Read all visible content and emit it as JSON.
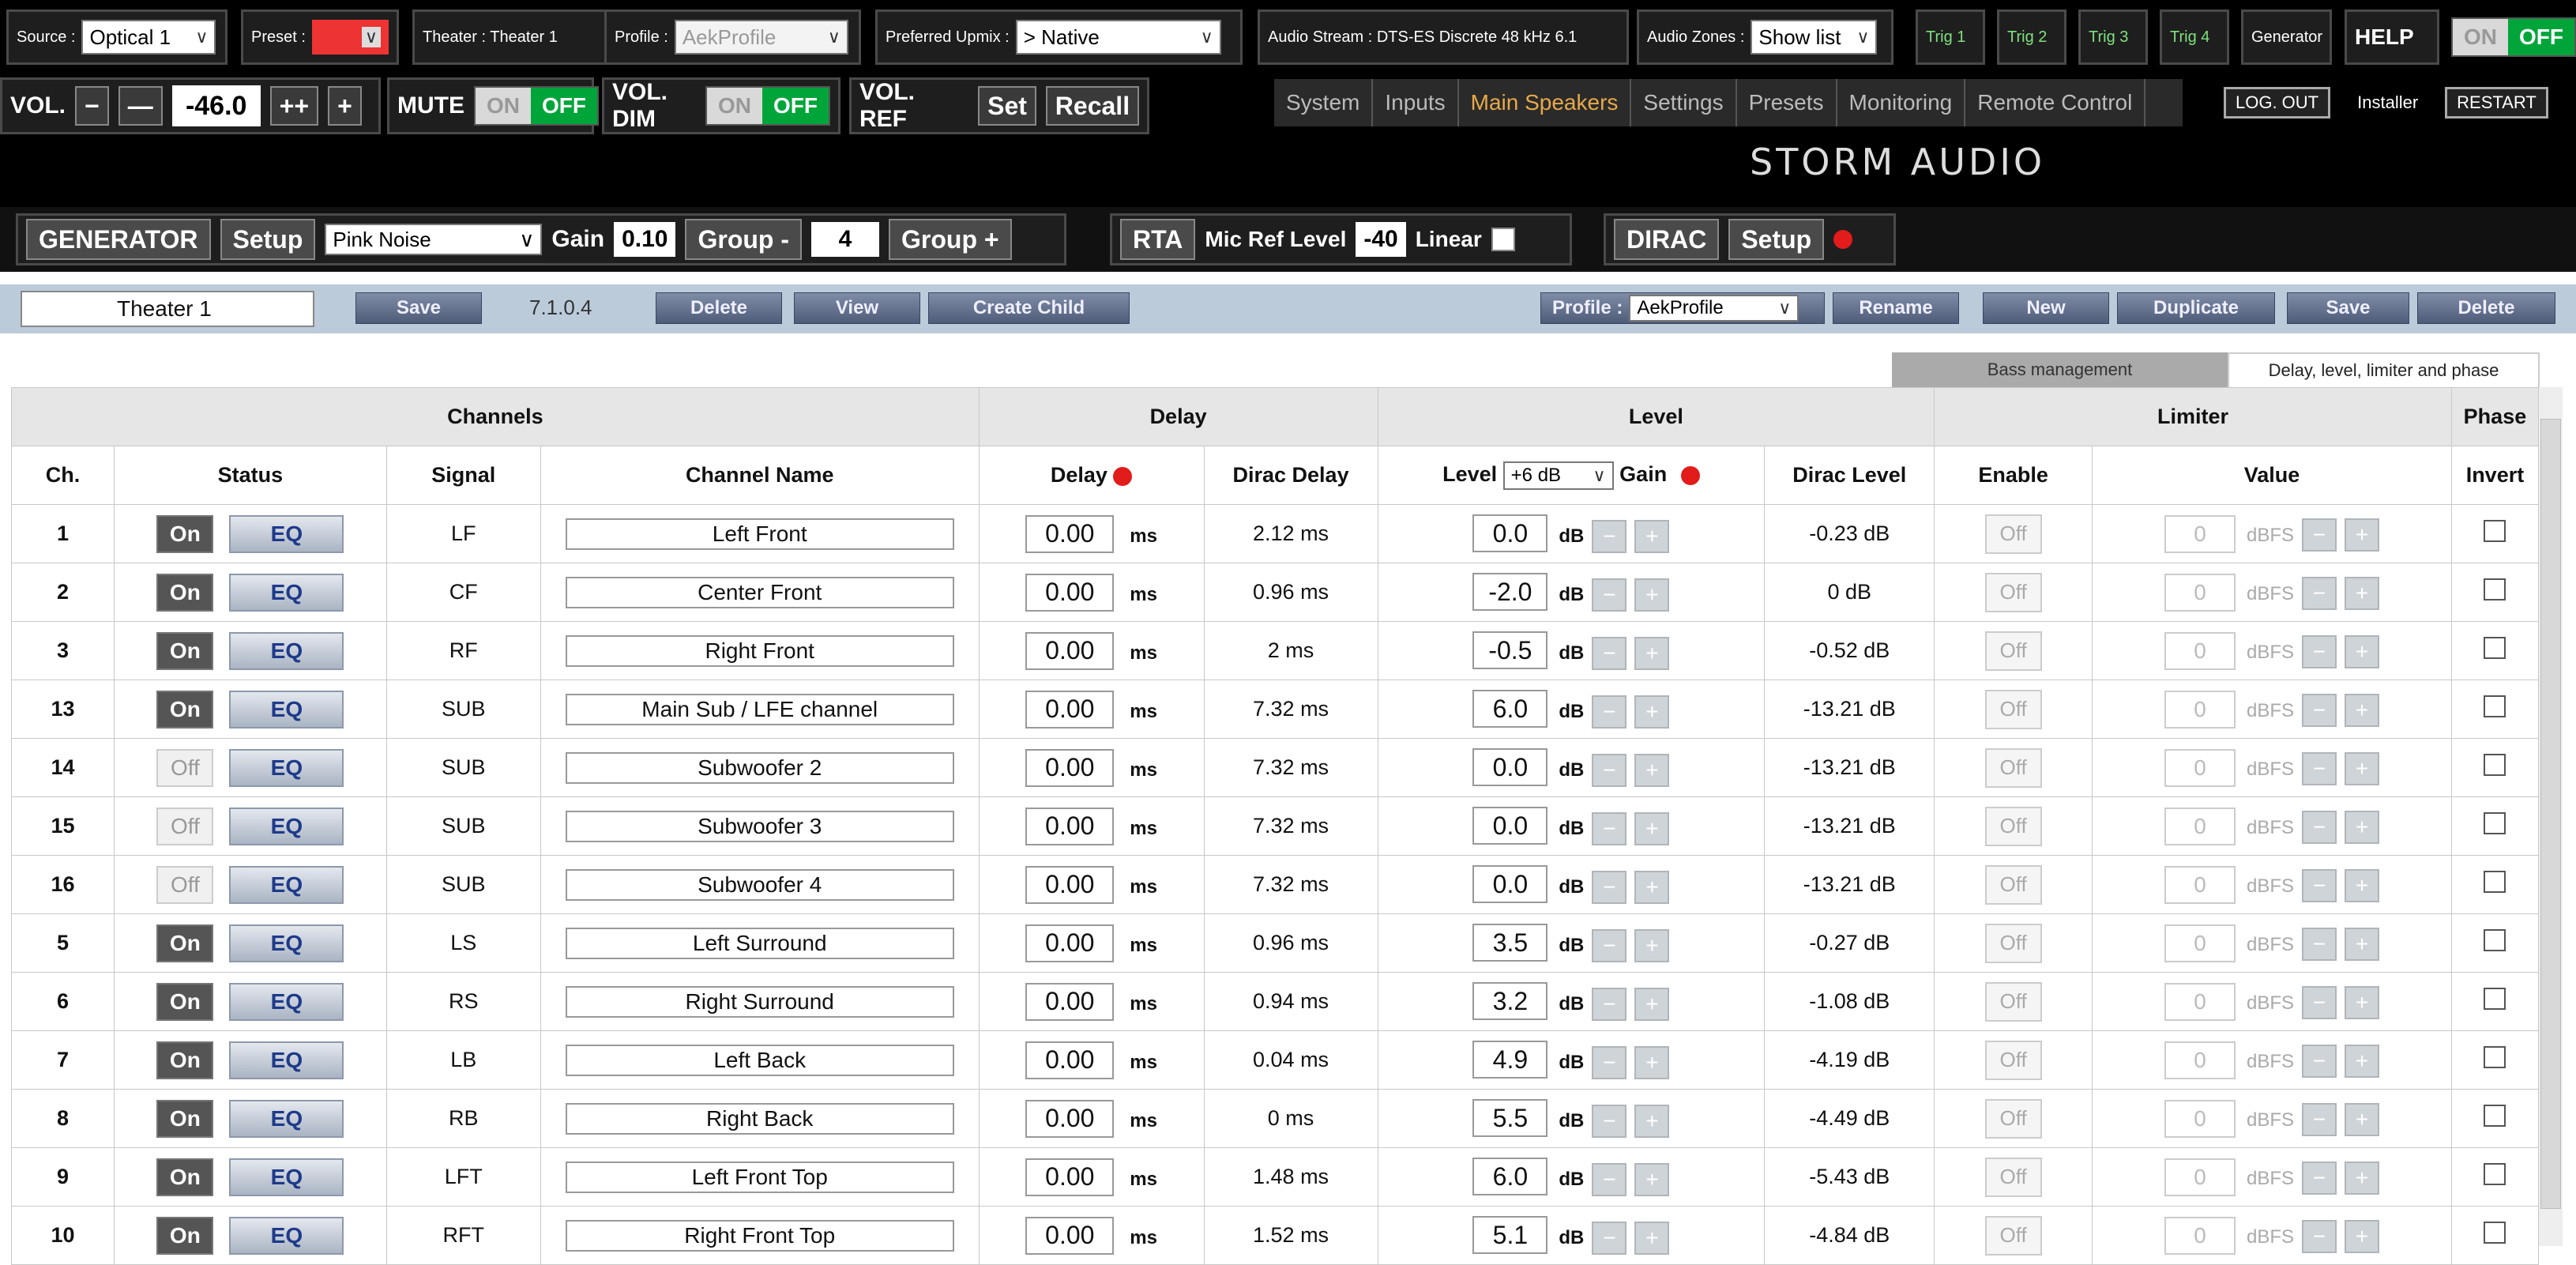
{
  "topbar": {
    "source_label": "Source :",
    "source_value": "Optical 1",
    "preset_label": "Preset :",
    "theater": "Theater : Theater 1",
    "profile_label": "Profile :",
    "profile_value": "AekProfile",
    "upmix_label": "Preferred Upmix :",
    "upmix_value": "> Native",
    "audio_stream": "Audio Stream : DTS-ES Discrete 48 kHz 6.1",
    "zones_label": "Audio Zones :",
    "zones_value": "Show list",
    "trig1": "Trig 1",
    "trig2": "Trig 2",
    "trig3": "Trig 3",
    "trig4": "Trig 4",
    "generator": "Generator",
    "help": "HELP",
    "on": "ON",
    "off": "OFF"
  },
  "controls": {
    "vol": "VOL.",
    "minus": "−",
    "dminus": "—",
    "vol_value": "-46.0",
    "dplus": "++",
    "plus": "+",
    "mute": "MUTE",
    "vol_dim": "VOL. DIM",
    "vol_ref": "VOL. REF",
    "set": "Set",
    "recall": "Recall",
    "on": "ON",
    "off": "OFF"
  },
  "nav": {
    "items": [
      "System",
      "Inputs",
      "Main Speakers",
      "Settings",
      "Presets",
      "Monitoring",
      "Remote Control"
    ],
    "logout": "LOG. OUT",
    "user": "Installer",
    "restart": "RESTART"
  },
  "logo": "STORM AUDIO",
  "generator": {
    "title": "GENERATOR",
    "setup": "Setup",
    "noise": "Pink Noise",
    "gain_label": "Gain",
    "gain_value": "0.10",
    "group_minus": "Group -",
    "group_value": "4",
    "group_plus": "Group +",
    "rta": "RTA",
    "mic_ref": "Mic Ref Level",
    "mic_value": "-40",
    "linear": "Linear",
    "dirac": "DIRAC",
    "dirac_setup": "Setup"
  },
  "theater_bar": {
    "name": "Theater 1",
    "save": "Save",
    "version": "7.1.0.4",
    "delete": "Delete",
    "view": "View",
    "create_child": "Create Child",
    "profile_label": "Profile :",
    "profile_value": "AekProfile",
    "rename": "Rename",
    "new": "New",
    "duplicate": "Duplicate",
    "save2": "Save",
    "delete2": "Delete"
  },
  "tabs": {
    "bass": "Bass management",
    "delay": "Delay, level, limiter and phase"
  },
  "table": {
    "groups": {
      "channels": "Channels",
      "delay": "Delay",
      "level": "Level",
      "limiter": "Limiter",
      "phase": "Phase"
    },
    "headers": {
      "ch": "Ch.",
      "status": "Status",
      "signal": "Signal",
      "name": "Channel Name",
      "delay": "Delay",
      "dirac_delay": "Dirac Delay",
      "level": "Level",
      "level_sel": "+6 dB",
      "gain": "Gain",
      "dirac_level": "Dirac Level",
      "enable": "Enable",
      "value": "Value",
      "invert": "Invert"
    },
    "units": {
      "ms": "ms",
      "db": "dB",
      "dbfs": "dBFS",
      "on": "On",
      "off": "Off",
      "eq": "EQ",
      "limit": "0"
    },
    "rows": [
      {
        "ch": "1",
        "on": true,
        "signal": "LF",
        "name": "Left Front",
        "delay": "0.00",
        "dirac_delay": "2.12 ms",
        "level": "0.0",
        "dirac_level": "-0.23 dB"
      },
      {
        "ch": "2",
        "on": true,
        "signal": "CF",
        "name": "Center Front",
        "delay": "0.00",
        "dirac_delay": "0.96 ms",
        "level": "-2.0",
        "dirac_level": "0 dB"
      },
      {
        "ch": "3",
        "on": true,
        "signal": "RF",
        "name": "Right Front",
        "delay": "0.00",
        "dirac_delay": "2 ms",
        "level": "-0.5",
        "dirac_level": "-0.52 dB"
      },
      {
        "ch": "13",
        "on": true,
        "signal": "SUB",
        "name": "Main Sub / LFE channel",
        "delay": "0.00",
        "dirac_delay": "7.32 ms",
        "level": "6.0",
        "dirac_level": "-13.21 dB"
      },
      {
        "ch": "14",
        "on": false,
        "signal": "SUB",
        "name": "Subwoofer 2",
        "delay": "0.00",
        "dirac_delay": "7.32 ms",
        "level": "0.0",
        "dirac_level": "-13.21 dB"
      },
      {
        "ch": "15",
        "on": false,
        "signal": "SUB",
        "name": "Subwoofer 3",
        "delay": "0.00",
        "dirac_delay": "7.32 ms",
        "level": "0.0",
        "dirac_level": "-13.21 dB"
      },
      {
        "ch": "16",
        "on": false,
        "signal": "SUB",
        "name": "Subwoofer 4",
        "delay": "0.00",
        "dirac_delay": "7.32 ms",
        "level": "0.0",
        "dirac_level": "-13.21 dB"
      },
      {
        "ch": "5",
        "on": true,
        "signal": "LS",
        "name": "Left Surround",
        "delay": "0.00",
        "dirac_delay": "0.96 ms",
        "level": "3.5",
        "dirac_level": "-0.27 dB"
      },
      {
        "ch": "6",
        "on": true,
        "signal": "RS",
        "name": "Right Surround",
        "delay": "0.00",
        "dirac_delay": "0.94 ms",
        "level": "3.2",
        "dirac_level": "-1.08 dB"
      },
      {
        "ch": "7",
        "on": true,
        "signal": "LB",
        "name": "Left Back",
        "delay": "0.00",
        "dirac_delay": "0.04 ms",
        "level": "4.9",
        "dirac_level": "-4.19 dB"
      },
      {
        "ch": "8",
        "on": true,
        "signal": "RB",
        "name": "Right Back",
        "delay": "0.00",
        "dirac_delay": "0 ms",
        "level": "5.5",
        "dirac_level": "-4.49 dB"
      },
      {
        "ch": "9",
        "on": true,
        "signal": "LFT",
        "name": "Left Front Top",
        "delay": "0.00",
        "dirac_delay": "1.48 ms",
        "level": "6.0",
        "dirac_level": "-5.43 dB"
      },
      {
        "ch": "10",
        "on": true,
        "signal": "RFT",
        "name": "Right Front Top",
        "delay": "0.00",
        "dirac_delay": "1.52 ms",
        "level": "5.1",
        "dirac_level": "-4.84 dB"
      }
    ]
  }
}
